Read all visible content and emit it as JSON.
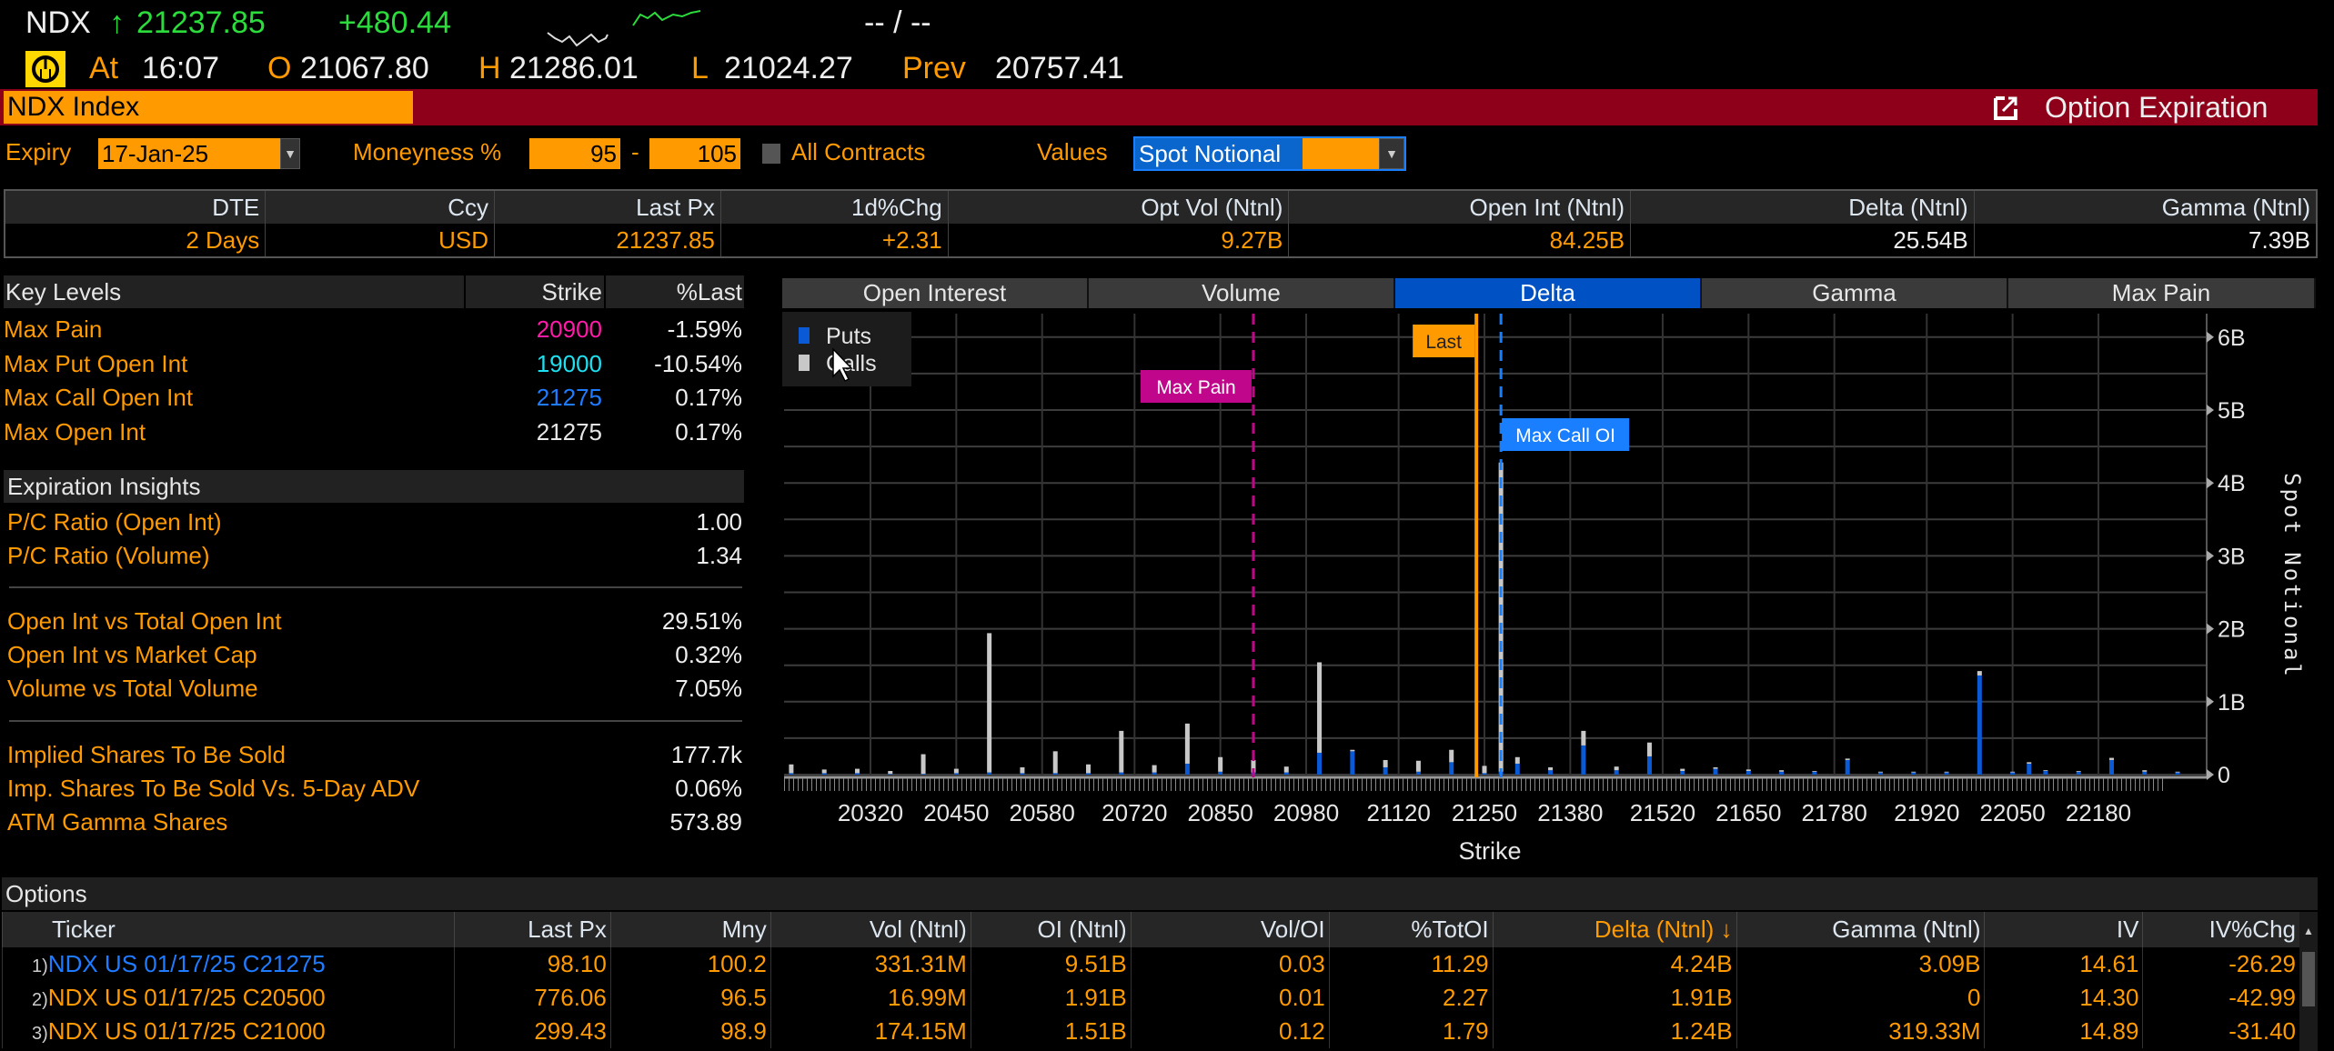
{
  "ticker_bar": {
    "symbol": "NDX",
    "arrow": "↑",
    "last": "21237.85",
    "change": "+480.44",
    "bid_ask": "-- / --",
    "at_label": "At",
    "time": "16:07",
    "open_label": "O",
    "open": "21067.80",
    "high_label": "H",
    "high": "21286.01",
    "low_label": "L",
    "low": "21024.27",
    "prev_label": "Prev",
    "prev": "20757.41",
    "status_icon": "market-clock-icon"
  },
  "title_bar": {
    "security": "NDX Index",
    "function_name": "Option Expiration",
    "icon": "external-link-icon",
    "color": "#8e0019"
  },
  "filters": {
    "expiry_label": "Expiry",
    "expiry_value": "17-Jan-25",
    "moneyness_label": "Moneyness %",
    "moneyness_low": "95",
    "moneyness_sep": "-",
    "moneyness_high": "105",
    "all_contracts_label": "All Contracts",
    "all_contracts_checked": false,
    "values_label": "Values",
    "values_value": "Spot Notional"
  },
  "summary": {
    "headers": [
      "DTE",
      "Ccy",
      "Last Px",
      "1d%Chg",
      "Opt Vol (Ntnl)",
      "Open Int (Ntnl)",
      "Delta (Ntnl)",
      "Gamma (Ntnl)"
    ],
    "values": [
      "2 Days",
      "USD",
      "21237.85",
      "+2.31",
      "9.27B",
      "84.25B",
      "25.54B",
      "7.39B"
    ]
  },
  "key_levels": {
    "title": "Key Levels",
    "strike_header": "Strike",
    "pct_header": "%Last",
    "rows": [
      {
        "label": "Max Pain",
        "strike": "20900",
        "pct": "-1.59%",
        "color": "#ff1aa8"
      },
      {
        "label": "Max Put Open Int",
        "strike": "19000",
        "pct": "-10.54%",
        "color": "#1ee0f0"
      },
      {
        "label": "Max Call Open Int",
        "strike": "21275",
        "pct": "0.17%",
        "color": "#1f7bff"
      },
      {
        "label": "Max Open Int",
        "strike": "21275",
        "pct": "0.17%",
        "color": "#e6e6e6"
      }
    ]
  },
  "insights": {
    "title": "Expiration Insights",
    "groups": [
      [
        {
          "label": "P/C Ratio (Open Int)",
          "value": "1.00"
        },
        {
          "label": "P/C Ratio (Volume)",
          "value": "1.34"
        }
      ],
      [
        {
          "label": "Open Int vs Total Open Int",
          "value": "29.51%"
        },
        {
          "label": "Open Int vs Market Cap",
          "value": "0.32%"
        },
        {
          "label": "Volume vs Total Volume",
          "value": "7.05%"
        }
      ],
      [
        {
          "label": "Implied Shares To Be Sold",
          "value": "177.7k"
        },
        {
          "label": "Imp. Shares To Be Sold Vs. 5-Day ADV",
          "value": "0.06%"
        },
        {
          "label": "ATM Gamma Shares",
          "value": "573.89"
        }
      ]
    ]
  },
  "chart_tabs": [
    {
      "label": "Open Interest",
      "active": false
    },
    {
      "label": "Volume",
      "active": false
    },
    {
      "label": "Delta",
      "active": true
    },
    {
      "label": "Gamma",
      "active": false
    },
    {
      "label": "Max Pain",
      "active": false
    }
  ],
  "chart_data": {
    "type": "bar",
    "stacked": true,
    "xlabel": "Strike",
    "ylabel": "Spot Notional",
    "x_ticks": [
      20320,
      20450,
      20580,
      20720,
      20850,
      20980,
      21120,
      21250,
      21380,
      21520,
      21650,
      21780,
      21920,
      22050,
      22180
    ],
    "y_ticks": [
      "0",
      "1B",
      "2B",
      "3B",
      "4B",
      "5B",
      "6B"
    ],
    "ylim": [
      0,
      6.3
    ],
    "y_unit": "B",
    "grid": true,
    "legend": "top-left",
    "series": [
      {
        "name": "Puts",
        "color": "#0a5ad6"
      },
      {
        "name": "Calls",
        "color": "#c8c8c8"
      }
    ],
    "strikes": [
      20200,
      20250,
      20300,
      20350,
      20400,
      20450,
      20500,
      20550,
      20600,
      20650,
      20700,
      20750,
      20800,
      20850,
      20900,
      20950,
      21000,
      21050,
      21100,
      21150,
      21200,
      21250,
      21275,
      21300,
      21350,
      21400,
      21450,
      21500,
      21550,
      21600,
      21650,
      21700,
      21750,
      21800,
      21850,
      21900,
      21950,
      22000,
      22050,
      22075,
      22100,
      22150,
      22200,
      22250,
      22300
    ],
    "puts": [
      0.02,
      0.02,
      0.02,
      0.01,
      0.01,
      0.02,
      0.03,
      0.02,
      0.02,
      0.02,
      0.03,
      0.03,
      0.15,
      0.04,
      0.03,
      0.03,
      0.3,
      0.32,
      0.1,
      0.04,
      0.17,
      0.02,
      0.04,
      0.15,
      0.06,
      0.4,
      0.06,
      0.25,
      0.05,
      0.08,
      0.05,
      0.04,
      0.04,
      0.2,
      0.03,
      0.03,
      0.03,
      1.36,
      0.03,
      0.15,
      0.05,
      0.04,
      0.2,
      0.04,
      0.03
    ],
    "calls": [
      0.12,
      0.05,
      0.06,
      0.04,
      0.27,
      0.06,
      1.91,
      0.08,
      0.3,
      0.12,
      0.57,
      0.1,
      0.55,
      0.2,
      0.17,
      0.08,
      1.24,
      0.02,
      0.1,
      0.15,
      0.17,
      0.1,
      4.24,
      0.09,
      0.04,
      0.2,
      0.05,
      0.19,
      0.03,
      0.02,
      0.02,
      0.02,
      0.01,
      0.02,
      0.01,
      0.01,
      0.01,
      0.06,
      0.01,
      0.02,
      0.01,
      0.01,
      0.03,
      0.02,
      0.01
    ],
    "markers": [
      {
        "label": "Max Pain",
        "strike": 20900,
        "color": "#c0068a",
        "style": "dashed"
      },
      {
        "label": "Last",
        "strike": 21237.85,
        "color": "#ff9a00",
        "style": "solid"
      },
      {
        "label": "Max Call OI",
        "strike": 21275,
        "color": "#1a7fff",
        "style": "dashed"
      }
    ]
  },
  "options": {
    "title": "Options",
    "headers": [
      "Ticker",
      "Last Px",
      "Mny",
      "Vol (Ntnl)",
      "OI (Ntnl)",
      "Vol/OI",
      "%TotOI",
      "Delta (Ntnl) ↓",
      "Gamma (Ntnl)",
      "IV",
      "IV%Chg"
    ],
    "sorted_column": "Delta (Ntnl) ↓",
    "rows": [
      {
        "n": "1)",
        "ticker": "NDX US 01/17/25 C21275",
        "highlight": true,
        "cells": [
          "98.10",
          "100.2",
          "331.31M",
          "9.51B",
          "0.03",
          "11.29",
          "4.24B",
          "3.09B",
          "14.61",
          "-26.29"
        ]
      },
      {
        "n": "2)",
        "ticker": "NDX US 01/17/25 C20500",
        "highlight": false,
        "cells": [
          "776.06",
          "96.5",
          "16.99M",
          "1.91B",
          "0.01",
          "2.27",
          "1.91B",
          "0",
          "14.30",
          "-42.99"
        ]
      },
      {
        "n": "3)",
        "ticker": "NDX US 01/17/25 C21000",
        "highlight": false,
        "cells": [
          "299.43",
          "98.9",
          "174.15M",
          "1.51B",
          "0.12",
          "1.79",
          "1.24B",
          "319.33M",
          "14.89",
          "-31.40"
        ]
      }
    ]
  }
}
